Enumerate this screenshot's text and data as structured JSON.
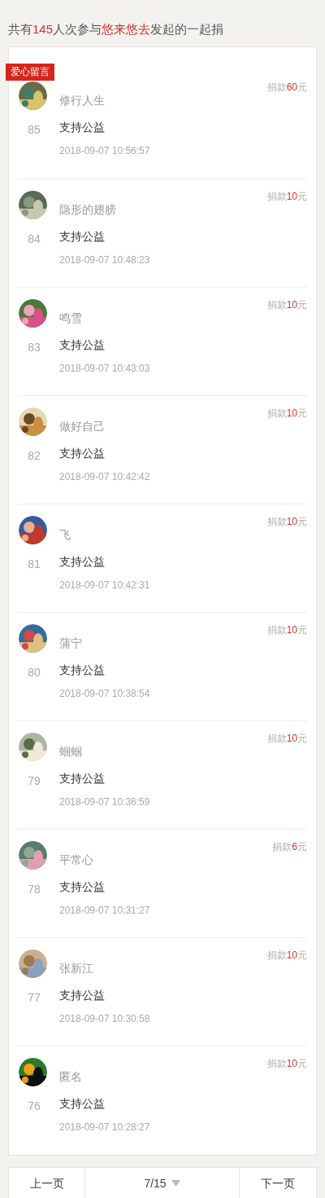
{
  "summary": [
    {
      "text": "共有",
      "highlight": false
    },
    {
      "text": "145",
      "highlight": true
    },
    {
      "text": "人次参与",
      "highlight": false
    },
    {
      "text": "悠来悠去",
      "highlight": true
    },
    {
      "text": "发起的一起捐",
      "highlight": false
    }
  ],
  "badge": "爱心留言",
  "donations": [
    {
      "rank": "85",
      "name": "修行人生",
      "message": "支持公益",
      "time": "2018-09-07 10:56:57",
      "amount_label": "捐款",
      "amount": "60",
      "unit": "元"
    },
    {
      "rank": "84",
      "name": "隐形的翅膀",
      "message": "支持公益",
      "time": "2018-09-07 10:48:23",
      "amount_label": "捐款",
      "amount": "10",
      "unit": "元"
    },
    {
      "rank": "83",
      "name": "鸣雪",
      "message": "支持公益",
      "time": "2018-09-07 10:43:03",
      "amount_label": "捐款",
      "amount": "10",
      "unit": "元"
    },
    {
      "rank": "82",
      "name": "做好自己",
      "message": "支持公益",
      "time": "2018-09-07 10:42:42",
      "amount_label": "捐款",
      "amount": "10",
      "unit": "元"
    },
    {
      "rank": "81",
      "name": "飞",
      "message": "支持公益",
      "time": "2018-09-07 10:42:31",
      "amount_label": "捐款",
      "amount": "10",
      "unit": "元"
    },
    {
      "rank": "80",
      "name": "蒲宁",
      "message": "支持公益",
      "time": "2018-09-07 10:38:54",
      "amount_label": "捐款",
      "amount": "10",
      "unit": "元"
    },
    {
      "rank": "79",
      "name": "蝈蝈",
      "message": "支持公益",
      "time": "2018-09-07 10:36:59",
      "amount_label": "捐款",
      "amount": "10",
      "unit": "元"
    },
    {
      "rank": "78",
      "name": "平常心",
      "message": "支持公益",
      "time": "2018-09-07 10:31:27",
      "amount_label": "捐款",
      "amount": "6",
      "unit": "元"
    },
    {
      "rank": "77",
      "name": "张新江",
      "message": "支持公益",
      "time": "2018-09-07 10:30:58",
      "amount_label": "捐款",
      "amount": "10",
      "unit": "元"
    },
    {
      "rank": "76",
      "name": "匿名",
      "message": "支持公益",
      "time": "2018-09-07 10:28:27",
      "amount_label": "捐款",
      "amount": "10",
      "unit": "元"
    }
  ],
  "pagination": {
    "previous": "上一页",
    "page": "7/15",
    "next": "下一页"
  }
}
